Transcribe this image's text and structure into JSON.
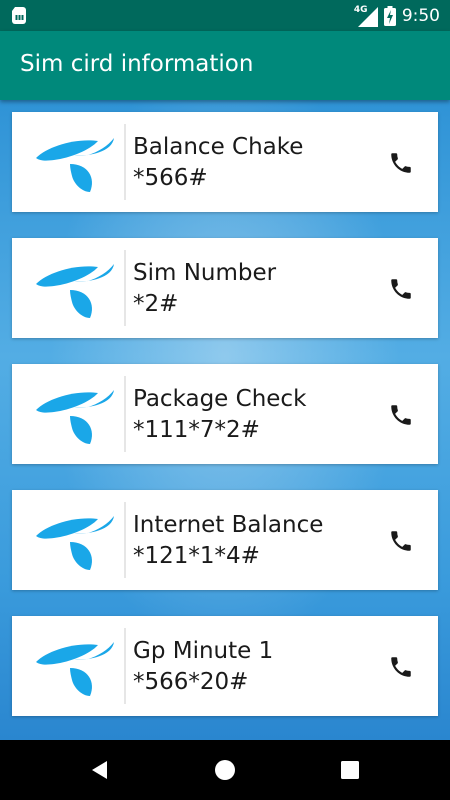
{
  "status_bar": {
    "network_label": "4G",
    "time": "9:50",
    "icons": [
      "sim-card-icon",
      "network-signal-icon",
      "battery-charging-icon"
    ]
  },
  "app_bar": {
    "title": "Sim cird information"
  },
  "colors": {
    "status_bar": "#00695c",
    "app_bar": "#00897b",
    "logo_blue": "#1aa7e8",
    "background_blue": "#3a9bdc"
  },
  "items": [
    {
      "title": "Balance Chake",
      "code": "*566#",
      "icon": "telenor-logo-icon",
      "action_icon": "phone-call-icon"
    },
    {
      "title": "Sim Number",
      "code": "*2#",
      "icon": "telenor-logo-icon",
      "action_icon": "phone-call-icon"
    },
    {
      "title": "Package Check",
      "code": "*111*7*2#",
      "icon": "telenor-logo-icon",
      "action_icon": "phone-call-icon"
    },
    {
      "title": "Internet Balance",
      "code": "*121*1*4#",
      "icon": "telenor-logo-icon",
      "action_icon": "phone-call-icon"
    },
    {
      "title": "Gp Minute 1",
      "code": "*566*20#",
      "icon": "telenor-logo-icon",
      "action_icon": "phone-call-icon"
    }
  ],
  "nav_bar": {
    "buttons": [
      "back-icon",
      "home-icon",
      "recents-icon"
    ]
  }
}
